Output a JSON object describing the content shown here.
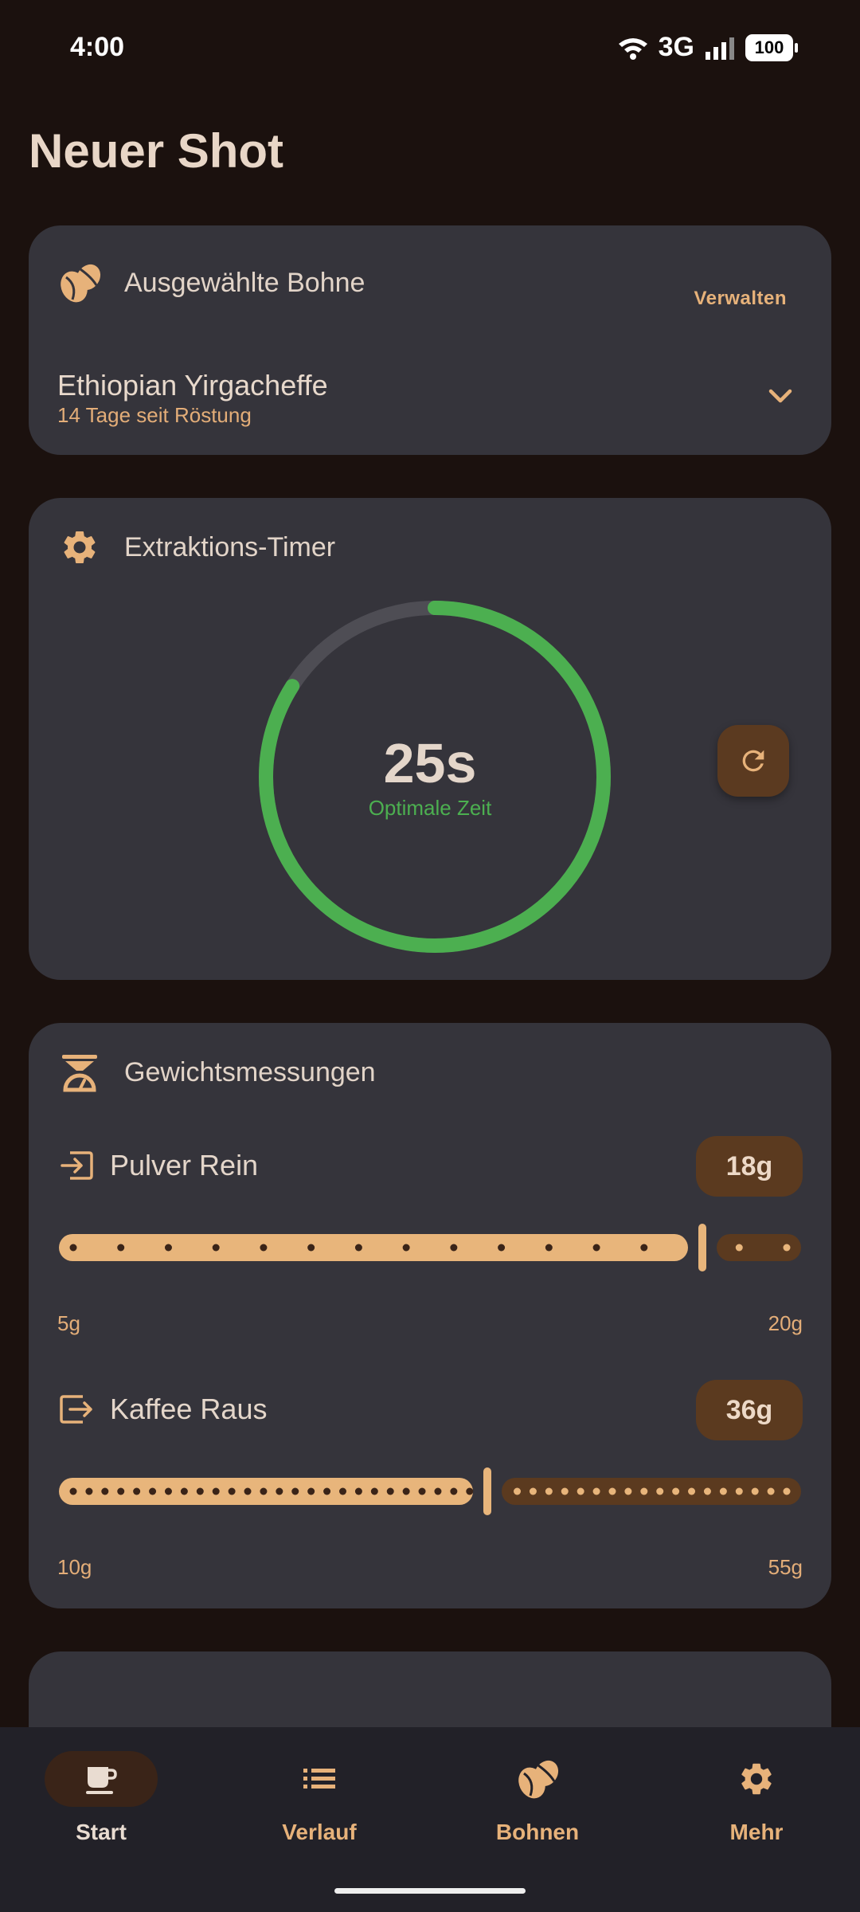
{
  "status_bar": {
    "time": "4:00",
    "network": "3G",
    "battery": "100"
  },
  "page": {
    "title": "Neuer Shot"
  },
  "bean_card": {
    "title": "Ausgewählte Bohne",
    "manage_label": "Verwalten",
    "bean_name": "Ethiopian Yirgacheffe",
    "roast_info": "14 Tage seit Röstung"
  },
  "timer_card": {
    "title": "Extraktions-Timer",
    "value": "25s",
    "status": "Optimale Zeit",
    "progress_fraction": 0.84,
    "colors": {
      "progress": "#4caf50",
      "track": "#4e4d54"
    }
  },
  "weight_card": {
    "title": "Gewichtsmessungen",
    "dose": {
      "label": "Pulver Rein",
      "value": "18g",
      "min": "5g",
      "max": "20g",
      "min_value": 5,
      "max_value": 20,
      "current": 18
    },
    "yield": {
      "label": "Kaffee Raus",
      "value": "36g",
      "min": "10g",
      "max": "55g",
      "min_value": 10,
      "max_value": 55,
      "current": 36
    }
  },
  "bottom_nav": {
    "items": [
      {
        "label": "Start",
        "icon": "coffee-cup-icon",
        "active": true
      },
      {
        "label": "Verlauf",
        "icon": "list-icon",
        "active": false
      },
      {
        "label": "Bohnen",
        "icon": "coffee-bean-icon",
        "active": false
      },
      {
        "label": "Mehr",
        "icon": "gear-icon",
        "active": false
      }
    ]
  },
  "colors": {
    "accent": "#e7b27a",
    "background": "#1b110e",
    "card": "#35343b",
    "slider_active": "#e8b57b",
    "slider_inactive": "#5b3a1f"
  }
}
